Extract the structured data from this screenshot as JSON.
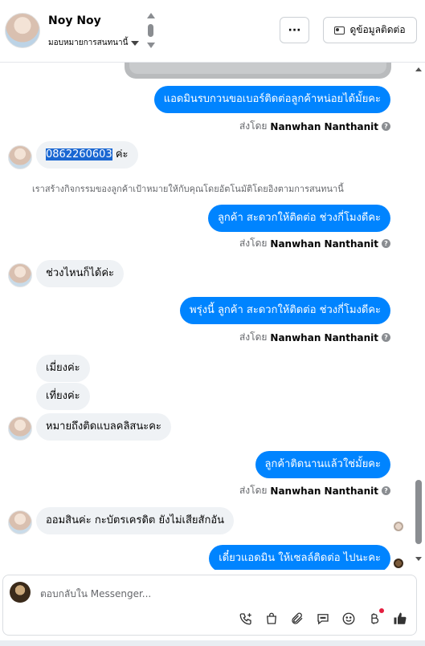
{
  "header": {
    "contact_name": "Noy Noy",
    "assign_label": "มอบหมายการสนทนานี้",
    "more_label": "···",
    "view_contact_label": "ดูข้อมูลติดต่อ"
  },
  "conversation": {
    "messages": [
      {
        "dir": "out",
        "text": "แอดมินรบกวนขอเบอร์ติดต่อลูกค้าหน่อยได้มั้ยคะ",
        "sent_by_prefix": "ส่งโดย",
        "sent_by_name": "Nanwhan Nanthanit"
      },
      {
        "dir": "in",
        "phone": "0862260603",
        "suffix": " ค่ะ"
      },
      {
        "dir": "note",
        "text": "เราสร้างกิจกรรมของลูกค้าเป้าหมายให้กับคุณโดยอัตโนมัติโดยอิงตามการสนทนานี้"
      },
      {
        "dir": "out",
        "text": "ลูกค้า สะดวกให้ติดต่อ ช่วงกี่โมงดีคะ",
        "sent_by_prefix": "ส่งโดย",
        "sent_by_name": "Nanwhan Nanthanit"
      },
      {
        "dir": "in",
        "text": "ช่วงไหนก็ได้ค่ะ"
      },
      {
        "dir": "out",
        "text": "พรุ่งนี้ ลูกค้า สะดวกให้ติดต่อ ช่วงกี่โมงดีคะ",
        "sent_by_prefix": "ส่งโดย",
        "sent_by_name": "Nanwhan Nanthanit"
      },
      {
        "dir": "in",
        "text": "เมี่ยงค่ะ"
      },
      {
        "dir": "in",
        "text": "เที่ยงค่ะ"
      },
      {
        "dir": "in",
        "text": "หมายถึงติดแบลคลิสนะคะ"
      },
      {
        "dir": "out",
        "text": "ลูกค้าติดนานแล้วใช่มั้ยคะ",
        "sent_by_prefix": "ส่งโดย",
        "sent_by_name": "Nanwhan Nanthanit"
      },
      {
        "dir": "in",
        "text": "ออมสินค่ะ กะบัตรเครดิต ยังไม่เสียสักอัน"
      },
      {
        "dir": "out",
        "text": "เดี๋ยวแอดมิน ให้เซลล์ติดต่อ ไปนะคะ"
      }
    ]
  },
  "composer": {
    "placeholder": "ตอบกลับใน Messenger..."
  },
  "icons": {
    "call": "phone-plus-icon",
    "shop": "shopping-bag-icon",
    "attach": "paperclip-icon",
    "saved": "saved-reply-icon",
    "emoji": "emoji-icon",
    "payment": "baht-icon",
    "like": "thumbs-up-icon"
  },
  "colors": {
    "outgoing_bubble": "#0084ff",
    "incoming_bubble": "#eff2f5",
    "like_icon": "#333333",
    "notification_dot": "#e41e3f"
  }
}
